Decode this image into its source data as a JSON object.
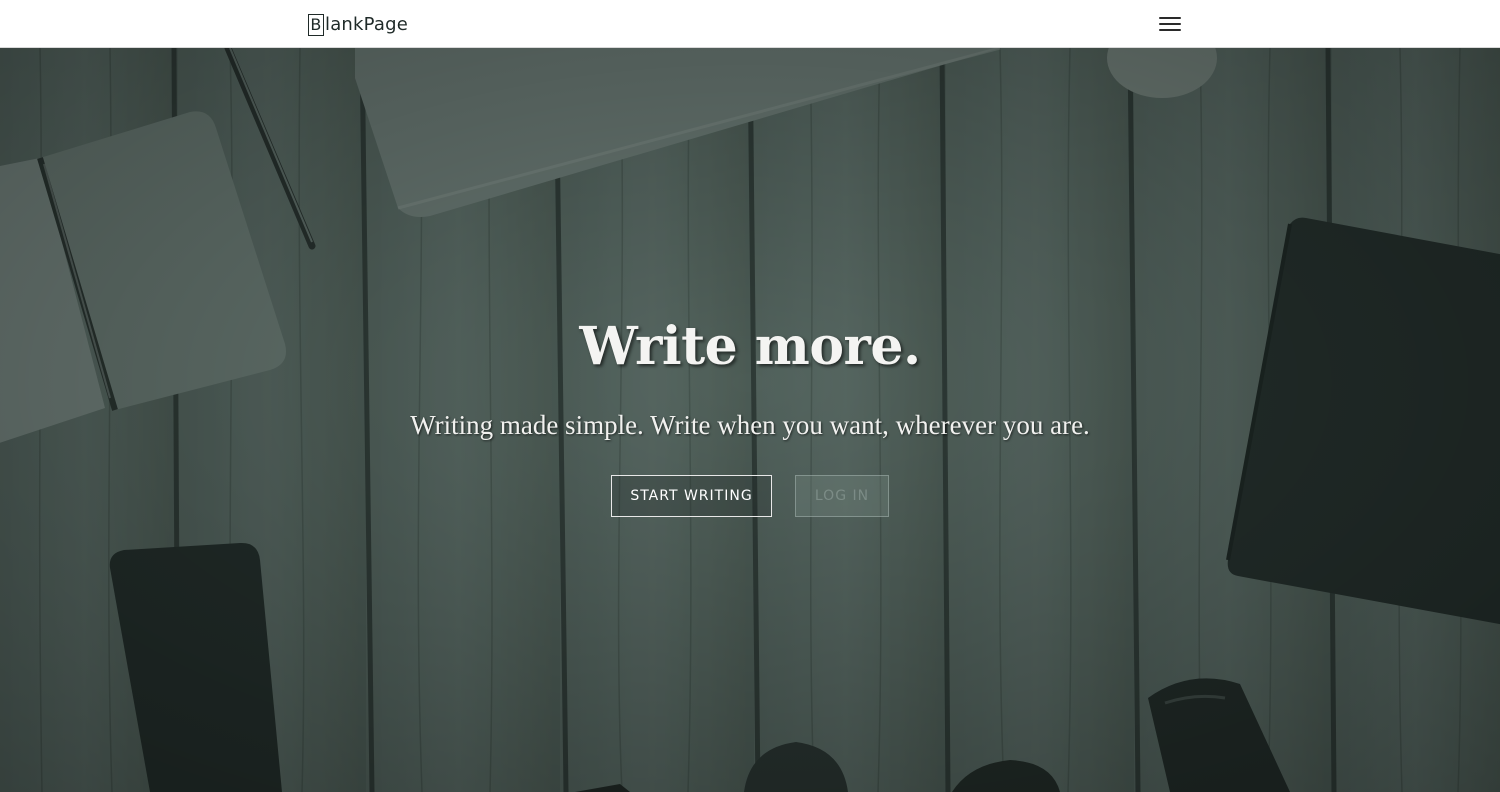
{
  "nav": {
    "logo_letter": "B",
    "logo_rest": "lankPage",
    "menu_icon": "hamburger-menu-icon"
  },
  "hero": {
    "title": "Write more.",
    "subtitle": "Writing made simple. Write when you want, wherever you are.",
    "start_button": "START WRITING",
    "login_button": "LOG IN",
    "background": "wood-desk-photo",
    "overlay_color": "#3c4a46"
  },
  "colors": {
    "navbar_bg": "#ffffff",
    "text_light": "#f4f4f2",
    "dark_object": "#17201e"
  }
}
